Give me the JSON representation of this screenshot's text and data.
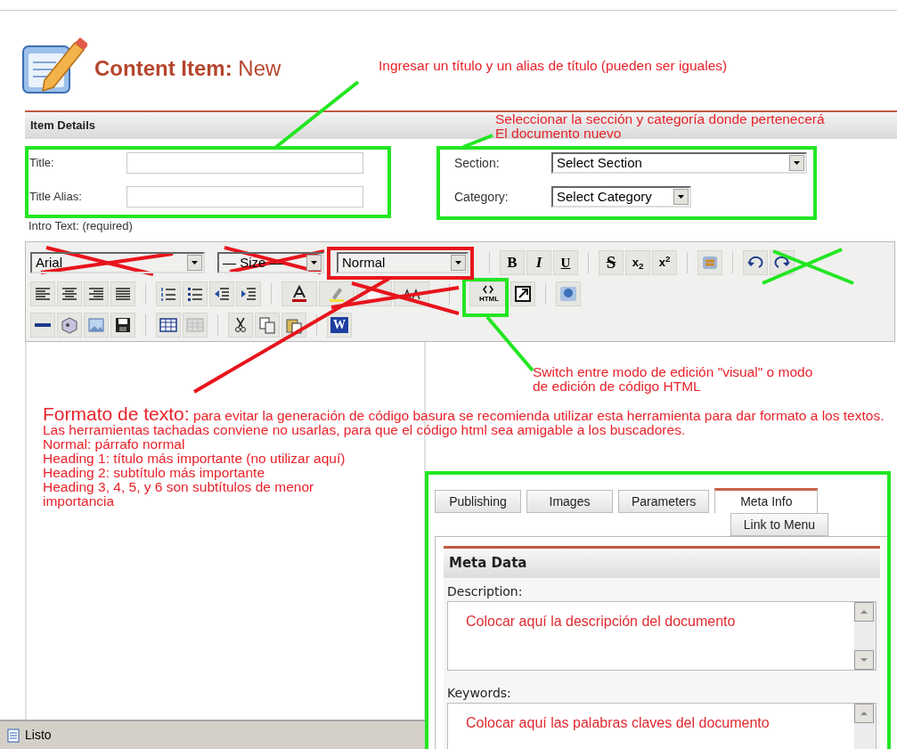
{
  "page_title": "**Content Item:** New",
  "item_details": {
    "heading": "Item Details",
    "fields": [
      {
        "label": "Title:"
      },
      {
        "label": "Title Alias:"
      }
    ],
    "selects": [
      {
        "label": "Section:",
        "value": "Select Section"
      },
      {
        "label": "Category:",
        "value": "Select Category"
      }
    ]
  },
  "editor": {
    "label": "Intro Text: (required)",
    "selects": [
      {
        "value": "Arial"
      },
      {
        "value": "— Size —"
      },
      {
        "value": "Normal"
      }
    ],
    "text_buttons": [
      "B",
      "I",
      "U",
      "S",
      "x$_{2}$",
      "x$^{2}$",
      "HTML",
      "W"
    ]
  },
  "tab_rows": [
    [
      {
        "label": "Publishing",
        "selected": false
      },
      {
        "label": "Images",
        "selected": false
      },
      {
        "label": "Parameters",
        "selected": false
      },
      {
        "label": "Meta Info",
        "selected": true
      }
    ],
    [
      {
        "label": "Link to Menu",
        "selected": false
      }
    ]
  ],
  "meta_data": {
    "heading": "Meta Data",
    "fields": [
      {
        "label": "Description:",
        "value": "Colocar aquí la descripción del documento"
      },
      {
        "label": "Keywords:",
        "value": "Colocar aquí las palabras claves del documento"
      }
    ]
  },
  "annotations": {
    "title_note": "Ingresar un título y un alias de título (pueden ser iguales)",
    "section_note": [
      "Seleccionar la sección y categoría donde pertenecerá",
      "El documento nuevo"
    ],
    "html_note": [
      "Switch entre modo de edición \"visual\" o modo",
      "de edición de código HTML"
    ],
    "format_lead": "Formato de texto:",
    "format_body": "para evitar la generación de código basura se recomienda utilizar esta herramienta para dar formato a los textos. Las herramientas tachadas conviene no usarlas, para que el código html sea amigable a los buscadores.",
    "format_items": [
      "Normal: párrafo normal",
      "Heading 1: título más importante (no utilizar aquí)",
      "Heading 2: subtítulo más importante",
      "Heading 3, 4, 5, y 6 son subtítulos de menor importancia"
    ]
  },
  "status_bar": "Listo"
}
